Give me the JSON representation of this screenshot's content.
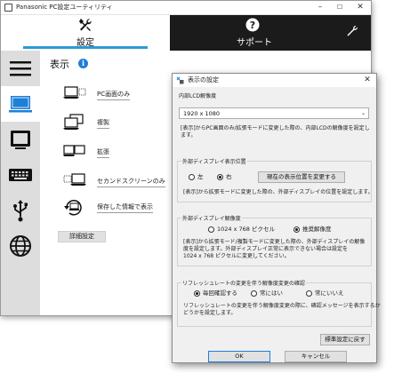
{
  "main_window": {
    "title": "Panasonic PC設定ユーティリティ",
    "minimize_glyph": "–",
    "maximize_glyph": "☐",
    "close_glyph": "✕"
  },
  "tabs": {
    "settings": {
      "label": "設定",
      "icon": "tools-crossed-icon"
    },
    "support": {
      "label": "サポート",
      "icon": "help-icon"
    },
    "tools_icon": "wrench-icon",
    "accent_color": "#2b9bd6"
  },
  "sidebar": {
    "items": [
      {
        "icon": "menu-icon"
      },
      {
        "icon": "laptop-display-icon",
        "active": true
      },
      {
        "icon": "tablet-icon"
      },
      {
        "icon": "keyboard-icon"
      },
      {
        "icon": "usb-icon"
      },
      {
        "icon": "globe-icon"
      }
    ]
  },
  "content": {
    "title": "表示",
    "info_glyph": "i",
    "modes": [
      {
        "label": "PC画面のみ",
        "icon": "pc-screen-only-icon"
      },
      {
        "label": "複製",
        "icon": "duplicate-icon"
      },
      {
        "label": "拡張",
        "icon": "extend-icon"
      },
      {
        "label": "セカンドスクリーンのみ",
        "icon": "second-screen-only-icon"
      },
      {
        "label": "保存した情報で表示",
        "icon": "restore-saved-icon"
      }
    ],
    "advanced_button": "詳細設定"
  },
  "dialog": {
    "title": "表示の設定",
    "close_glyph": "✕",
    "internal_lcd": {
      "heading": "内部LCD解像度",
      "selected": "1920 x 1080",
      "note_line1": "[表示]からPC画面のみ/拡張モードに変更した際の、内部LCDの解像度を設定し",
      "note_line2": "ます。"
    },
    "external_position": {
      "title": "外部ディスプレイ表示位置",
      "options": [
        "左",
        "右"
      ],
      "selected": "右",
      "change_button": "現在の表示位置を変更する",
      "note": "[表示]から拡張モードに変更した際の、外部ディスプレイの位置を設定します。"
    },
    "external_resolution": {
      "title": "外部ディスプレイ解像度",
      "options": [
        "1024 x 768 ピクセル",
        "推奨解像度"
      ],
      "selected": "推奨解像度",
      "note_line1": "[表示]から拡張モード/複製モードに変更した際の、外部ディスプレイの解像",
      "note_line2": "度を設定します。外部ディスプレイ正常に表示できない場合は設定を",
      "note_line3": "1024 x 768 ピクセルに変更してください。"
    },
    "refresh_rate": {
      "title": "リフレッシュレートの変更を伴う解像度変更の確認",
      "options": [
        "毎回確認する",
        "常にはい",
        "常にいいえ"
      ],
      "selected": "毎回確認する",
      "note_line1": "リフレッシュレートの変更を伴う解像度変更の際に、確認メッセージを表示するか",
      "note_line2": "どうかを設定します。"
    },
    "restore_defaults_button": "標準設定に戻す",
    "ok_button": "OK",
    "cancel_button": "キャンセル"
  }
}
